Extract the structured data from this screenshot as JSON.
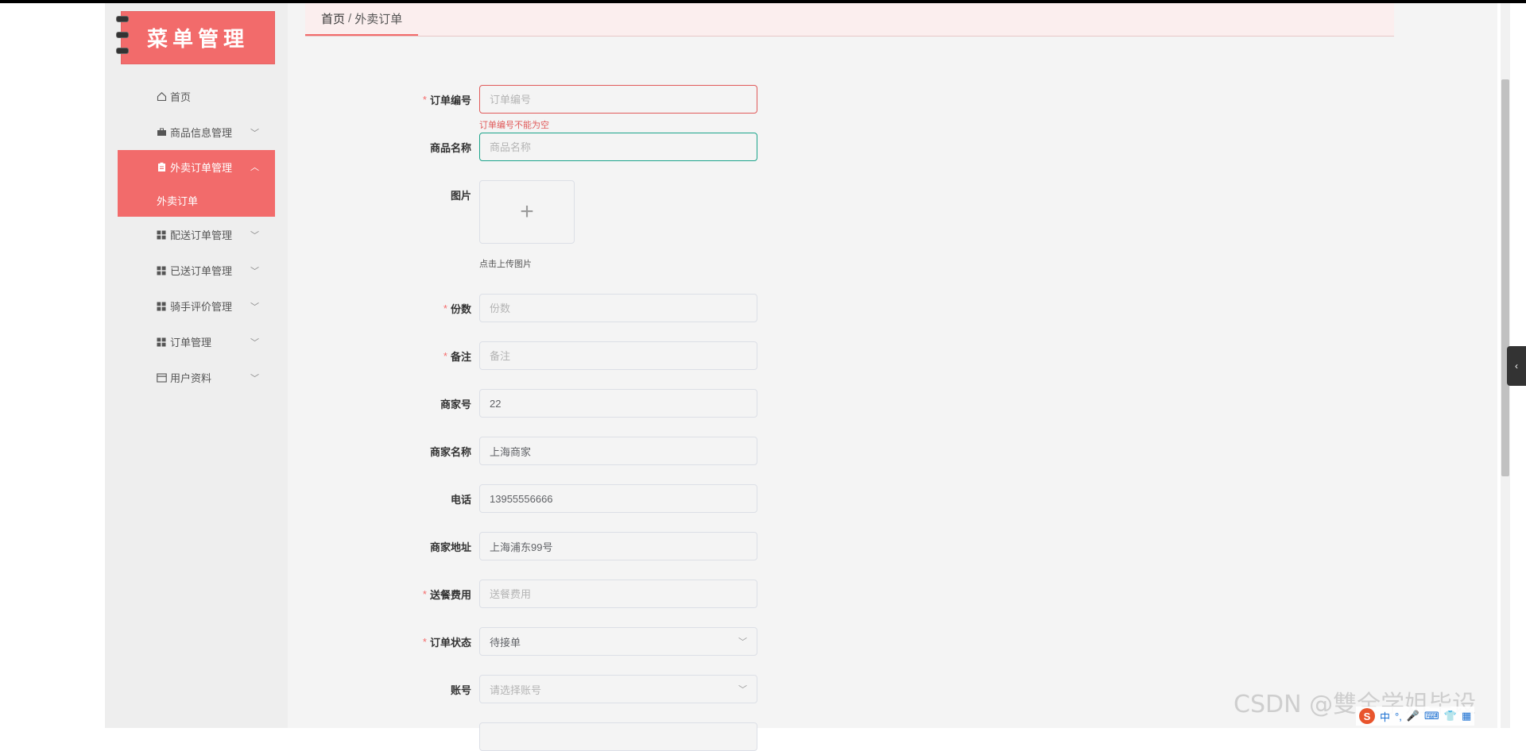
{
  "sidebar": {
    "logo_text": "菜单管理",
    "items": [
      {
        "label": "首页",
        "icon": "home-icon"
      },
      {
        "label": "商品信息管理",
        "icon": "briefcase-icon"
      },
      {
        "label": "外卖订单管理",
        "icon": "clipboard-icon",
        "active": true
      },
      {
        "label": "配送订单管理",
        "icon": "grid-icon"
      },
      {
        "label": "已送订单管理",
        "icon": "grid-icon"
      },
      {
        "label": "骑手评价管理",
        "icon": "grid-icon"
      },
      {
        "label": "订单管理",
        "icon": "grid-icon"
      },
      {
        "label": "用户资料",
        "icon": "card-icon"
      }
    ],
    "submenu_active": "外卖订单"
  },
  "breadcrumb": {
    "home": "首页",
    "separator": "/",
    "current": "外卖订单"
  },
  "form": {
    "order_no": {
      "label": "订单编号",
      "required": true,
      "placeholder": "订单编号",
      "value": "",
      "error": "订单编号不能为空"
    },
    "product_name": {
      "label": "商品名称",
      "required": false,
      "placeholder": "商品名称",
      "value": ""
    },
    "image": {
      "label": "图片",
      "tip": "点击上传图片"
    },
    "quantity": {
      "label": "份数",
      "required": true,
      "placeholder": "份数",
      "value": ""
    },
    "remark": {
      "label": "备注",
      "required": true,
      "placeholder": "备注",
      "value": ""
    },
    "merchant_no": {
      "label": "商家号",
      "value": "22"
    },
    "merchant_name": {
      "label": "商家名称",
      "value": "上海商家"
    },
    "phone": {
      "label": "电话",
      "value": "13955556666"
    },
    "merchant_address": {
      "label": "商家地址",
      "value": "上海浦东99号"
    },
    "delivery_fee": {
      "label": "送餐费用",
      "required": true,
      "placeholder": "送餐费用",
      "value": ""
    },
    "order_status": {
      "label": "订单状态",
      "required": true,
      "value": "待接单"
    },
    "account": {
      "label": "账号",
      "placeholder": "请选择账号",
      "value": ""
    }
  },
  "overlay": {
    "watermark": "CSDN @雙全学姐毕设",
    "ime": [
      "中",
      "°,",
      "🎤",
      "⌨",
      "👕",
      "▦"
    ]
  },
  "colors": {
    "accent": "#f26b6b",
    "error": "#e05a5a",
    "focus": "#1aa38a"
  }
}
